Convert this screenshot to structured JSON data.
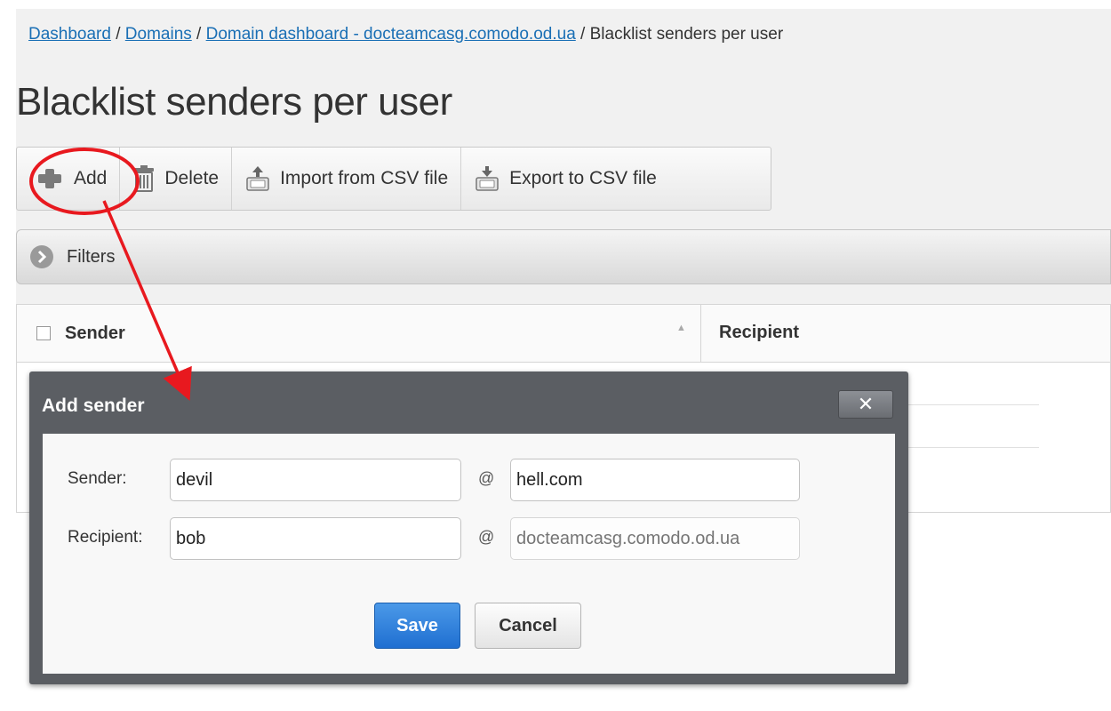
{
  "breadcrumb": {
    "items": [
      "Dashboard",
      "Domains",
      "Domain dashboard - docteamcasg.comodo.od.ua"
    ],
    "current": "Blacklist senders per user",
    "separator": " / "
  },
  "page": {
    "title": "Blacklist senders per user"
  },
  "toolbar": {
    "add": "Add",
    "delete": "Delete",
    "import": "Import from CSV file",
    "export": "Export to CSV file"
  },
  "filters": {
    "label": "Filters"
  },
  "grid": {
    "columns": [
      "Sender",
      "Recipient"
    ]
  },
  "dialog": {
    "title": "Add sender",
    "close_symbol": "✕",
    "sender_label": "Sender:",
    "recipient_label": "Recipient:",
    "at_symbol": "@",
    "sender_local": "devil",
    "sender_domain": "hell.com",
    "recipient_local": "bob",
    "recipient_domain_placeholder": "docteamcasg.comodo.od.ua",
    "save": "Save",
    "cancel": "Cancel"
  },
  "colors": {
    "link": "#1a6fb5",
    "annotation": "#e8191f",
    "save_button": "#2a7fdc",
    "dialog_frame": "#5b5e63"
  },
  "icons": [
    "plus-icon",
    "trash-icon",
    "csv-import-icon",
    "csv-export-icon",
    "chevron-right-icon",
    "close-icon"
  ]
}
